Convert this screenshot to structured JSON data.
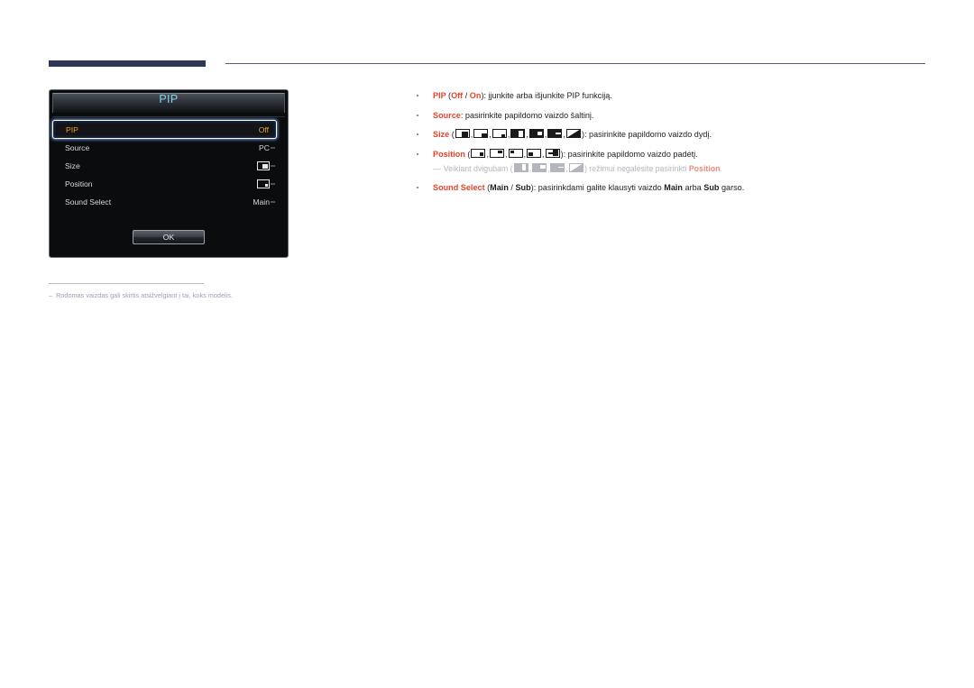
{
  "header": {
    "rule_accent_color": "#2e3756",
    "rule_thin_color": "#565b78"
  },
  "osd": {
    "title": "PIP",
    "title_color": "#7fd4ef",
    "highlight_color": "#e8a321",
    "rows": [
      {
        "label": "PIP",
        "value": "Off",
        "value_type": "text",
        "selected": true
      },
      {
        "label": "Source",
        "value": "PC",
        "value_type": "text",
        "selected": false
      },
      {
        "label": "Size",
        "value": "",
        "value_type": "size-icon",
        "selected": false
      },
      {
        "label": "Position",
        "value": "",
        "value_type": "position-icon",
        "selected": false
      },
      {
        "label": "Sound Select",
        "value": "Main",
        "value_type": "text",
        "selected": false
      }
    ],
    "ok_label": "OK"
  },
  "figure_note": {
    "dash": "–",
    "text": "Rodomas vaizdas gali skirtis atsižvelgiant į tai, koks modelis."
  },
  "content": {
    "accent_color": "#e8442a",
    "bullets": [
      {
        "id": "pip",
        "parts": [
          {
            "t": "PIP ",
            "style": "kw"
          },
          {
            "t": "(",
            "style": "plain"
          },
          {
            "t": "Off",
            "style": "kw"
          },
          {
            "t": " / ",
            "style": "plain"
          },
          {
            "t": "On",
            "style": "kw"
          },
          {
            "t": "): įjunkite arba išjunkite PIP funkciją.",
            "style": "plain"
          }
        ]
      },
      {
        "id": "source",
        "parts": [
          {
            "t": "Source",
            "style": "kw"
          },
          {
            "t": ": pasirinkite papildomo vaizdo šaltinį.",
            "style": "plain"
          }
        ]
      },
      {
        "id": "size",
        "parts": [
          {
            "t": "Size ",
            "style": "kw"
          },
          {
            "t": "(",
            "style": "plain"
          },
          {
            "t": "ICONS_SIZE",
            "style": "icons"
          },
          {
            "t": "): pasirinkite papildomo vaizdo dydį.",
            "style": "plain"
          }
        ]
      },
      {
        "id": "position",
        "parts": [
          {
            "t": "Position ",
            "style": "kw"
          },
          {
            "t": "(",
            "style": "plain"
          },
          {
            "t": "ICONS_POSITION",
            "style": "icons"
          },
          {
            "t": "): pasirinkite papildomo vaizdo padėtį.",
            "style": "plain"
          }
        ]
      },
      {
        "id": "sound-select",
        "parts": [
          {
            "t": "Sound Select ",
            "style": "kw"
          },
          {
            "t": "(",
            "style": "plain"
          },
          {
            "t": "Main",
            "style": "kb"
          },
          {
            "t": " / ",
            "style": "plain"
          },
          {
            "t": "Sub",
            "style": "kb"
          },
          {
            "t": "): pasirinkdami galite klausyti vaizdo ",
            "style": "plain"
          },
          {
            "t": "Main",
            "style": "kb"
          },
          {
            "t": " arba ",
            "style": "plain"
          },
          {
            "t": "Sub",
            "style": "kb"
          },
          {
            "t": " garso.",
            "style": "plain"
          }
        ]
      }
    ],
    "subnote": {
      "dash": "—",
      "pre": "Veikiant dvigubam (",
      "mid": ") režimui negalėsite pasirinkti ",
      "keyword": "Position",
      "post": "."
    }
  },
  "icons": {
    "size_glyphs": [
      "size-large-bottom-right",
      "size-medium-bottom-right",
      "size-small-bottom-right",
      "size-double-wide-split",
      "size-double-narrow-split",
      "size-double-bar",
      "size-diagonal-split"
    ],
    "position_glyphs": [
      "position-bottom-right",
      "position-top-right",
      "position-top-left",
      "position-bottom-left",
      "position-custom-move"
    ],
    "subnote_glyphs": [
      "size-double-wide-split",
      "size-double-narrow-split",
      "size-double-bar",
      "size-diagonal-split"
    ]
  }
}
